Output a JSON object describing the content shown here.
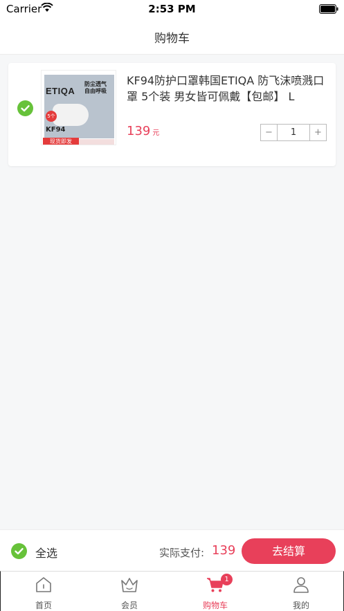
{
  "status_bar": {
    "carrier": "Carrier",
    "time": "2:53 PM",
    "icons": [
      "wifi-icon",
      "battery-icon"
    ]
  },
  "nav": {
    "title": "购物车"
  },
  "cart": {
    "items": [
      {
        "title": "KF94防护口罩韩国ETIQA 防飞沫喷溅口罩 5个装 男女皆可佩戴【包邮】 L",
        "price": "139",
        "price_unit": "元",
        "quantity": "1",
        "selected": true,
        "image": {
          "brand": "ETIQA",
          "slogan": "防尘透气 自由呼吸",
          "count": "5个",
          "model": "KF94",
          "tag": "现货即发"
        }
      }
    ]
  },
  "stepper": {
    "minus": "−",
    "plus": "+"
  },
  "checkout": {
    "select_all_label": "全选",
    "pay_label": "实际支付:",
    "total": "139",
    "button_label": "去结算"
  },
  "tabbar": {
    "tabs": [
      {
        "label": "首页",
        "icon": "home-icon"
      },
      {
        "label": "会员",
        "icon": "crown-icon"
      },
      {
        "label": "购物车",
        "icon": "cart-icon",
        "badge": "1",
        "active": true
      },
      {
        "label": "我的",
        "icon": "user-icon"
      }
    ]
  },
  "colors": {
    "accent": "#e8405a",
    "check": "#67c23a",
    "background": "#f6f7f8"
  }
}
